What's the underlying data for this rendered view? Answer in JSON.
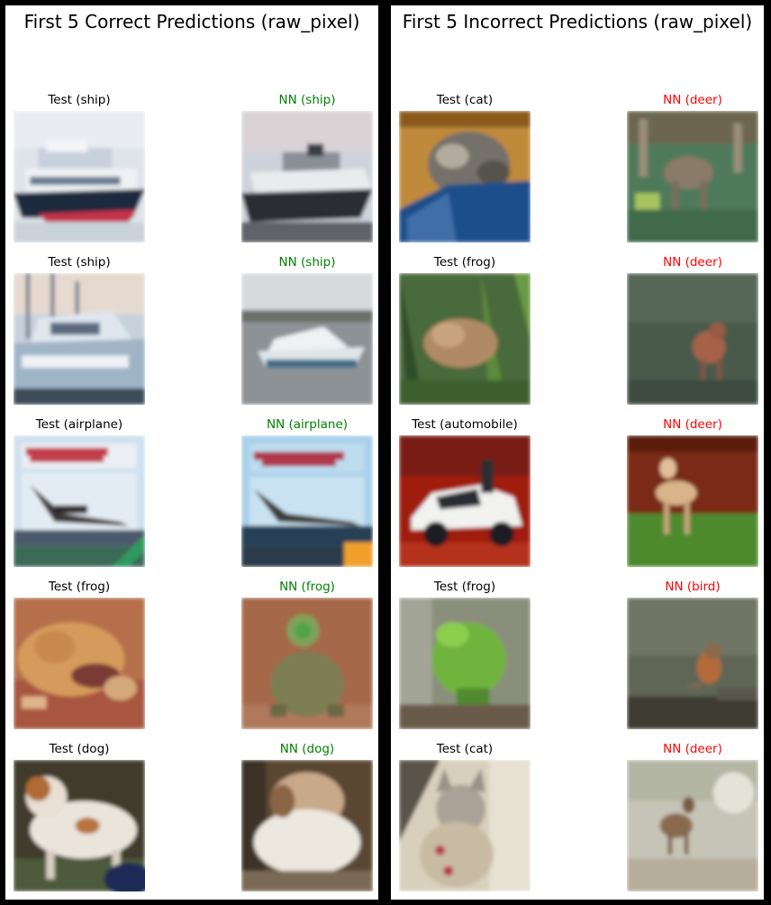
{
  "panels": [
    {
      "title": "First 5 Correct Predictions (raw_pixel)",
      "rows": [
        {
          "test": {
            "label": "Test (ship)",
            "scene": "ship-white"
          },
          "nn": {
            "label": "NN (ship)",
            "scene": "ship-dark",
            "correct": true
          }
        },
        {
          "test": {
            "label": "Test (ship)",
            "scene": "boat-harbor"
          },
          "nn": {
            "label": "NN (ship)",
            "scene": "boat-lake",
            "correct": true
          }
        },
        {
          "test": {
            "label": "Test (airplane)",
            "scene": "concorde-poster"
          },
          "nn": {
            "label": "NN (airplane)",
            "scene": "concorde-poster-2",
            "correct": true
          }
        },
        {
          "test": {
            "label": "Test (frog)",
            "scene": "toad-ground"
          },
          "nn": {
            "label": "NN (frog)",
            "scene": "frog-brown"
          },
          "correct": true
        },
        {
          "test": {
            "label": "Test (dog)",
            "scene": "dog-white-brown"
          },
          "nn": {
            "label": "NN (dog)",
            "scene": "dog-fluffy",
            "correct": true
          }
        }
      ]
    },
    {
      "title": "First 5 Incorrect Predictions (raw_pixel)",
      "rows": [
        {
          "test": {
            "label": "Test (cat)",
            "scene": "cat-blue-blanket"
          },
          "nn": {
            "label": "NN (deer)",
            "scene": "deer-green",
            "correct": false
          }
        },
        {
          "test": {
            "label": "Test (frog)",
            "scene": "frog-grass"
          },
          "nn": {
            "label": "NN (deer)",
            "scene": "deer-dark-grass",
            "correct": false
          }
        },
        {
          "test": {
            "label": "Test (automobile)",
            "scene": "car-white-red"
          },
          "nn": {
            "label": "NN (deer)",
            "scene": "deer-red-wall",
            "correct": false
          }
        },
        {
          "test": {
            "label": "Test (frog)",
            "scene": "frog-green"
          },
          "nn": {
            "label": "NN (bird)",
            "scene": "bird-robin",
            "correct": false
          }
        },
        {
          "test": {
            "label": "Test (cat)",
            "scene": "cat-grey-pillow"
          },
          "nn": {
            "label": "NN (deer)",
            "scene": "deer-foggy",
            "correct": false
          }
        }
      ]
    }
  ]
}
